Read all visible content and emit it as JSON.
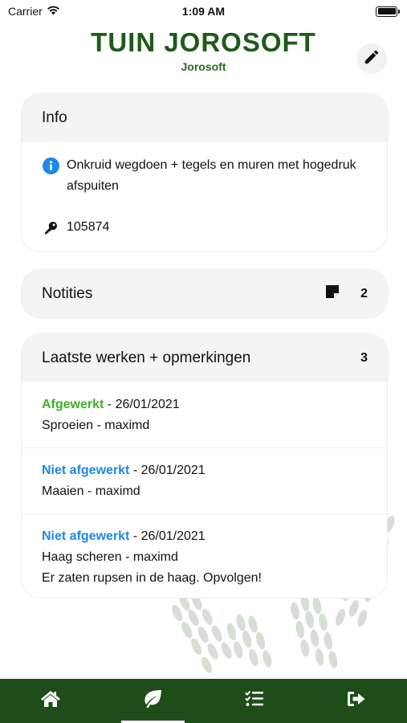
{
  "status_bar": {
    "carrier": "Carrier",
    "time": "1:09 AM"
  },
  "header": {
    "title": "TUIN JOROSOFT",
    "subtitle": "Jorosoft"
  },
  "info": {
    "title": "Info",
    "description": "Onkruid wegdoen + tegels en muren met hogedruk afspuiten",
    "code": "105874"
  },
  "notes": {
    "title": "Notities",
    "count": "2"
  },
  "works": {
    "title": "Laatste werken + opmerkingen",
    "count": "3",
    "items": [
      {
        "status": "Afgewerkt",
        "date": " - 26/01/2021",
        "line1": "Sproeien - maximd",
        "line2": ""
      },
      {
        "status": "Niet afgewerkt",
        "date": " - 26/01/2021",
        "line1": "Maaien - maximd",
        "line2": ""
      },
      {
        "status": "Niet afgewerkt",
        "date": " - 26/01/2021",
        "line1": "Haag scheren - maximd",
        "line2": "Er zaten rupsen in de haag. Opvolgen!"
      }
    ]
  },
  "tabs": [
    "home-icon",
    "leaf-icon",
    "checklist-icon",
    "sign-out-icon"
  ],
  "colors": {
    "brand_green": "#1f5a1a",
    "tabbar_green": "#1f4d1a",
    "done_green": "#3fae2a",
    "open_blue": "#1e88e5",
    "info_blue": "#1e88e5"
  }
}
